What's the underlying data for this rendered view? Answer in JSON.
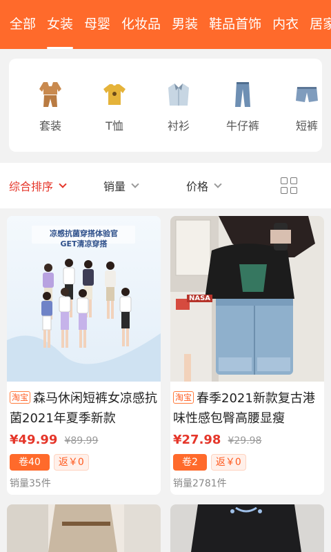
{
  "categories": [
    "全部",
    "女装",
    "母婴",
    "化妆品",
    "男装",
    "鞋品首饰",
    "内衣",
    "居家"
  ],
  "subcategories": [
    {
      "label": "套装",
      "icon": "suit-icon"
    },
    {
      "label": "T恤",
      "icon": "tshirt-icon"
    },
    {
      "label": "衬衫",
      "icon": "shirt-icon"
    },
    {
      "label": "牛仔裤",
      "icon": "jeans-icon"
    },
    {
      "label": "短裤",
      "icon": "shorts-icon"
    }
  ],
  "sort": {
    "comprehensive": "综合排序",
    "sales": "销量",
    "price": "价格"
  },
  "products": [
    {
      "platform": "淘宝",
      "title": "森马休闲短裤女凉感抗菌2021年夏季新款",
      "price": "¥49.99",
      "original_price": "¥89.99",
      "coupon": "卷40",
      "rebate": "返￥0",
      "sales": "销量35件",
      "image_text_1": "凉感抗菌穿搭体验官",
      "image_text_2": "GET清凉穿搭"
    },
    {
      "platform": "淘宝",
      "title": "春季2021新款复古港味性感包臀高腰显瘦",
      "price": "¥27.98",
      "original_price": "¥29.98",
      "coupon": "卷2",
      "rebate": "返￥0",
      "sales": "销量2781件",
      "image_text_1": "NASA"
    }
  ],
  "colors": {
    "accent": "#ff6a2b",
    "price": "#e5362a"
  }
}
